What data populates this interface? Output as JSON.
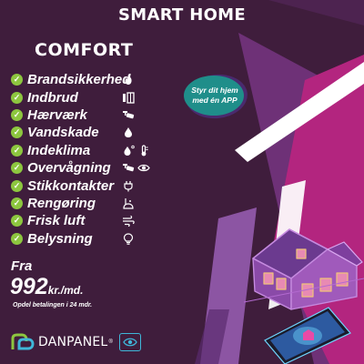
{
  "headline": "SMART HOME",
  "package": "COMFORT",
  "features": [
    {
      "label": "Brandsikkerhed",
      "icons": [
        "flame-icon"
      ]
    },
    {
      "label": "Indbrud",
      "icons": [
        "window-sensor-icon"
      ]
    },
    {
      "label": "Hærværk",
      "icons": [
        "camera-icon"
      ]
    },
    {
      "label": "Vandskade",
      "icons": [
        "water-drop-icon"
      ]
    },
    {
      "label": "Indeklima",
      "icons": [
        "humidity-icon",
        "thermometer-icon"
      ]
    },
    {
      "label": "Overvågning",
      "icons": [
        "camera-icon",
        "eye-icon"
      ]
    },
    {
      "label": "Stikkontakter",
      "icons": [
        "plug-icon"
      ]
    },
    {
      "label": "Rengøring",
      "icons": [
        "robot-vacuum-icon"
      ]
    },
    {
      "label": "Frisk luft",
      "icons": [
        "fan-icon"
      ]
    },
    {
      "label": "Belysning",
      "icons": [
        "bulb-icon"
      ]
    }
  ],
  "app_badge": {
    "line1": "Styr dit hjem",
    "line2": "med én APP"
  },
  "price": {
    "prefix": "Fra",
    "amount": "992",
    "unit": "kr./md.",
    "installment": "Opdel betalingen i 24 mdr."
  },
  "brand": {
    "name": "DANPANEL",
    "mark": "®"
  },
  "colors": {
    "background": "#3f1d3c",
    "panel_purple": "#6e3177",
    "accent_magenta": "#b3257f",
    "check_green": "#8dc63f",
    "badge_teal": "#1f8e8a",
    "brand_blue": "#3fb7d9"
  }
}
